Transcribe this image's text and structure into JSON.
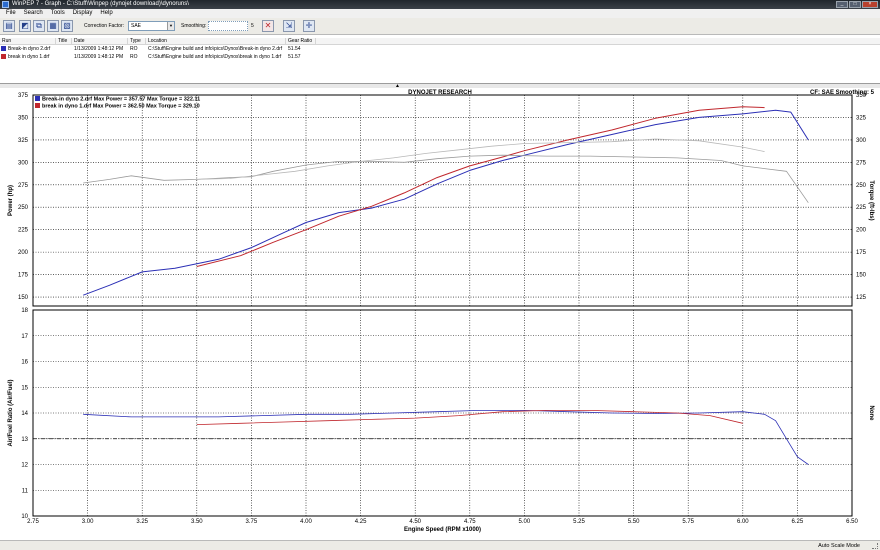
{
  "window": {
    "title": "WinPEP 7  -  Graph  -  C:\\Stuff\\Winpep (dynojet download)\\dynoruns\\",
    "buttons": {
      "minimize": "_",
      "maximize": "□",
      "close": "×"
    }
  },
  "menu": [
    "File",
    "Search",
    "Tools",
    "Display",
    "Help"
  ],
  "toolbar": {
    "correction_label": "Correction Factor:",
    "correction_value": "SAE",
    "smoothing_label": "Smoothing:",
    "smoothing_value": "5"
  },
  "runs": {
    "columns": [
      "Run",
      "Title",
      "Date",
      "Type",
      "Location",
      "Gear Ratio"
    ],
    "rows": [
      {
        "run": "Break-in dyno 2.drf",
        "title": "",
        "date": "1/13/2009 1:48:12 PM",
        "type": "RO",
        "location": "C:\\Stuff\\Engine build and info\\pics\\Dynos\\Break-in dyno 2.drf",
        "gear_ratio": "51.54",
        "color": "#2b2fb5"
      },
      {
        "run": "break in dyno 1.drf",
        "title": "",
        "date": "1/13/2009 1:48:12 PM",
        "type": "RO",
        "location": "C:\\Stuff\\Engine build and info\\pics\\Dynos\\break in dyno 1.drf",
        "gear_ratio": "51.57",
        "color": "#c0272d"
      }
    ]
  },
  "graph_header": {
    "title": "DYNOJET RESEARCH",
    "cf": "CF: SAE  Smoothing: 5"
  },
  "status": {
    "mode": "Auto Scale Mode"
  },
  "chart_data": {
    "type": "line",
    "title": "DYNOJET RESEARCH",
    "xlabel": "Engine Speed (RPM x1000)",
    "xlim": [
      2.75,
      6.5
    ],
    "x_ticks": [
      "2.75",
      "3.00",
      "3.25",
      "3.50",
      "3.75",
      "4.00",
      "4.25",
      "4.50",
      "4.75",
      "5.00",
      "5.25",
      "5.50",
      "5.75",
      "6.00",
      "6.25",
      "6.50"
    ],
    "grid": true,
    "legend": [
      {
        "text": "Break-in dyno 2.drf Max Power = 357.57 Max Torque = 322.11",
        "color": "#2b2fb5"
      },
      {
        "text": "break in dyno 1.drf Max Power = 362.50 Max Torque = 329.10",
        "color": "#c0272d"
      }
    ],
    "upper": {
      "ylabel_left": "Power (hp)",
      "ylabel_right": "Torque (ft-lbs)",
      "ylim": [
        140,
        375
      ],
      "left_ticks": [
        "150",
        "175",
        "200",
        "225",
        "250",
        "275",
        "300",
        "325",
        "350",
        "375"
      ],
      "right_ticks": [
        "125",
        "150",
        "175",
        "200",
        "225",
        "250",
        "275",
        "300",
        "325",
        "350"
      ],
      "series": [
        {
          "name": "Break-in dyno 2.drf Power",
          "color": "#2b2fb5",
          "width": 1.0,
          "x": [
            2.98,
            3.1,
            3.25,
            3.4,
            3.6,
            3.75,
            3.9,
            4.0,
            4.15,
            4.3,
            4.45,
            4.6,
            4.75,
            4.9,
            5.0,
            5.2,
            5.4,
            5.6,
            5.8,
            6.0,
            6.15,
            6.22,
            6.3
          ],
          "y": [
            152,
            163,
            178,
            182,
            192,
            205,
            222,
            233,
            244,
            249,
            259,
            276,
            291,
            302,
            308,
            320,
            331,
            342,
            350,
            354,
            358,
            356,
            325
          ]
        },
        {
          "name": "break in dyno 1.drf Power",
          "color": "#c0272d",
          "width": 1.0,
          "x": [
            3.5,
            3.7,
            3.85,
            4.0,
            4.15,
            4.3,
            4.45,
            4.6,
            4.75,
            4.9,
            5.0,
            5.2,
            5.4,
            5.6,
            5.8,
            6.0,
            6.1
          ],
          "y": [
            184,
            196,
            211,
            225,
            240,
            251,
            266,
            283,
            296,
            306,
            313,
            325,
            336,
            349,
            358,
            362,
            361
          ]
        },
        {
          "name": "Break-in dyno 2.drf Torque",
          "color": "#9a9a9a",
          "width": 0.8,
          "x": [
            2.98,
            3.1,
            3.2,
            3.35,
            3.5,
            3.65,
            3.75,
            3.85,
            4.0,
            4.15,
            4.3,
            4.45,
            4.6,
            4.75,
            4.9,
            5.1,
            5.3,
            5.5,
            5.7,
            5.9,
            6.0,
            6.1,
            6.2,
            6.3
          ],
          "y": [
            277,
            281,
            285,
            280,
            281,
            283,
            284,
            290,
            297,
            301,
            301,
            300,
            304,
            307,
            308,
            307,
            307,
            306,
            305,
            302,
            296,
            293,
            290,
            255
          ]
        },
        {
          "name": "break in dyno 1.drf Torque",
          "color": "#b8b8b8",
          "width": 0.8,
          "x": [
            3.5,
            3.65,
            3.8,
            3.95,
            4.1,
            4.25,
            4.4,
            4.55,
            4.7,
            4.85,
            5.0,
            5.2,
            5.4,
            5.6,
            5.8,
            6.0,
            6.1
          ],
          "y": [
            281,
            282,
            286,
            290,
            296,
            301,
            305,
            310,
            314,
            318,
            321,
            322,
            323,
            326,
            324,
            317,
            312
          ]
        }
      ]
    },
    "lower": {
      "ylabel_left": "Air/Fuel Ratio (Air/Fuel)",
      "ylabel_right": "None",
      "ylim": [
        10,
        18
      ],
      "left_ticks": [
        "10",
        "11",
        "12",
        "13",
        "14",
        "15",
        "16",
        "17",
        "18"
      ],
      "reference_line": 13,
      "series": [
        {
          "name": "Break-in dyno 2.drf AFR",
          "color": "#2b2fb5",
          "width": 0.8,
          "x": [
            2.98,
            3.2,
            3.4,
            3.6,
            3.8,
            4.0,
            4.2,
            4.4,
            4.6,
            4.8,
            5.0,
            5.2,
            5.4,
            5.6,
            5.8,
            6.0,
            6.1,
            6.15,
            6.2,
            6.25,
            6.3
          ],
          "y": [
            13.95,
            13.85,
            13.85,
            13.85,
            13.9,
            13.95,
            13.95,
            14.0,
            14.05,
            14.1,
            14.1,
            14.05,
            14.0,
            13.98,
            14.0,
            14.05,
            13.95,
            13.7,
            13.0,
            12.3,
            12.0
          ]
        },
        {
          "name": "break in dyno 1.drf AFR",
          "color": "#c0272d",
          "width": 0.8,
          "x": [
            3.5,
            3.7,
            3.9,
            4.1,
            4.3,
            4.5,
            4.7,
            4.9,
            5.1,
            5.3,
            5.5,
            5.7,
            5.85,
            6.0
          ],
          "y": [
            13.55,
            13.6,
            13.65,
            13.7,
            13.75,
            13.8,
            13.9,
            14.05,
            14.1,
            14.1,
            14.05,
            14.0,
            13.9,
            13.6
          ]
        }
      ]
    }
  }
}
